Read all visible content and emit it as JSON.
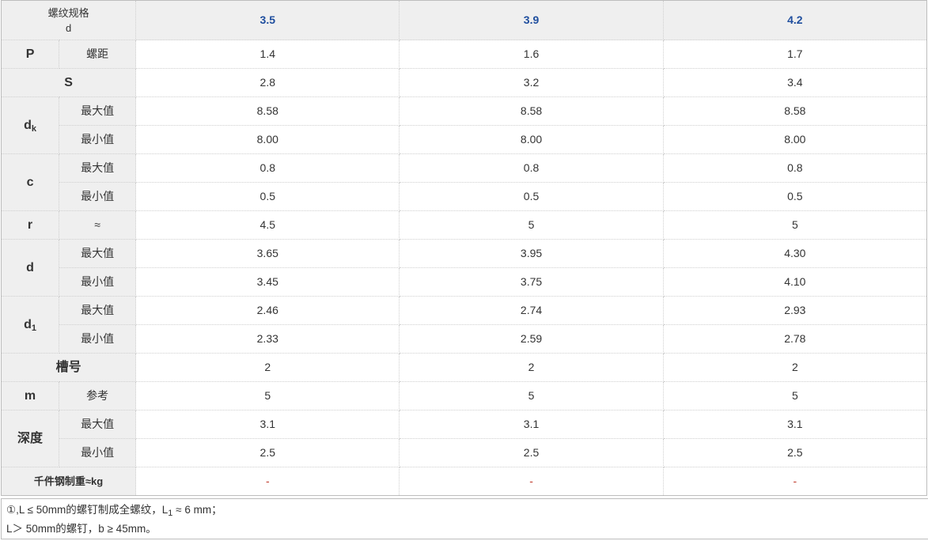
{
  "header": {
    "corner_line1": "螺纹规格",
    "corner_line2": "d",
    "columns": [
      "3.5",
      "3.9",
      "4.2"
    ]
  },
  "rows": {
    "P": {
      "label": "P",
      "sub": "螺距",
      "values": [
        "1.4",
        "1.6",
        "1.7"
      ]
    },
    "S": {
      "label": "S",
      "values": [
        "2.8",
        "3.2",
        "3.4"
      ]
    },
    "dk": {
      "label": "d",
      "label_sub": "k",
      "max_label": "最大值",
      "min_label": "最小值",
      "max": [
        "8.58",
        "8.58",
        "8.58"
      ],
      "min": [
        "8.00",
        "8.00",
        "8.00"
      ]
    },
    "c": {
      "label": "c",
      "max_label": "最大值",
      "min_label": "最小值",
      "max": [
        "0.8",
        "0.8",
        "0.8"
      ],
      "min": [
        "0.5",
        "0.5",
        "0.5"
      ]
    },
    "r": {
      "label": "r",
      "sub": "≈",
      "values": [
        "4.5",
        "5",
        "5"
      ]
    },
    "d": {
      "label": "d",
      "max_label": "最大值",
      "min_label": "最小值",
      "max": [
        "3.65",
        "3.95",
        "4.30"
      ],
      "min": [
        "3.45",
        "3.75",
        "4.10"
      ]
    },
    "d1": {
      "label": "d",
      "label_sub": "1",
      "max_label": "最大值",
      "min_label": "最小值",
      "max": [
        "2.46",
        "2.74",
        "2.93"
      ],
      "min": [
        "2.33",
        "2.59",
        "2.78"
      ]
    },
    "slot": {
      "label": "槽号",
      "values": [
        "2",
        "2",
        "2"
      ]
    },
    "m": {
      "label": "m",
      "sub": "参考",
      "values": [
        "5",
        "5",
        "5"
      ]
    },
    "depth": {
      "label": "深度",
      "max_label": "最大值",
      "min_label": "最小值",
      "max": [
        "3.1",
        "3.1",
        "3.1"
      ],
      "min": [
        "2.5",
        "2.5",
        "2.5"
      ]
    },
    "weight": {
      "label": "千件钢制重≈kg",
      "values": [
        "-",
        "-",
        "-"
      ]
    }
  },
  "notes": {
    "line1_a": "①,L ≤ 50mm的螺钉制成全螺纹，L",
    "line1_sub": "1",
    "line1_b": " ≈ 6 mm；",
    "line2": "L＞ 50mm的螺钉，b ≥ 45mm。"
  },
  "colors": {
    "header_bg": "#efefef",
    "column_header_text": "#1f4e9e",
    "dash_text": "#c0392b"
  }
}
